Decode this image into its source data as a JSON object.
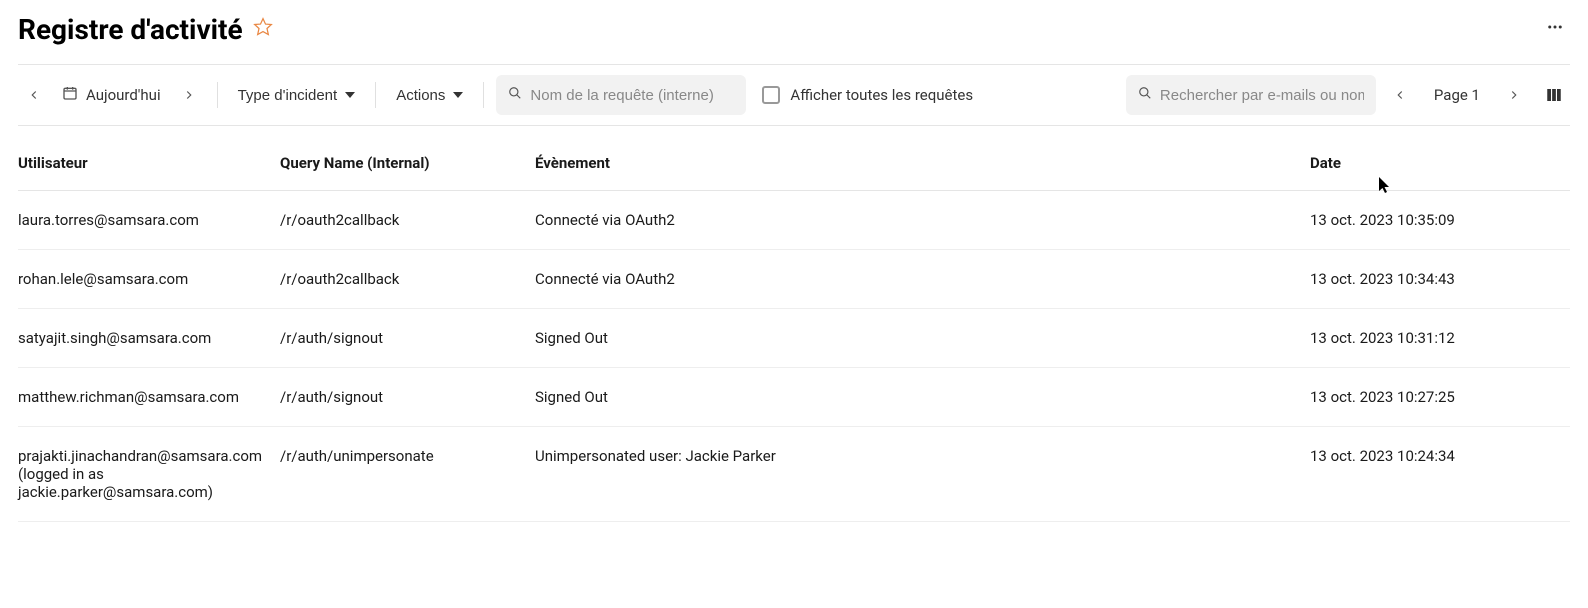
{
  "header": {
    "title": "Registre d'activité"
  },
  "toolbar": {
    "date_range": "Aujourd'hui",
    "incident_type_label": "Type d'incident",
    "actions_label": "Actions",
    "search_query_placeholder": "Nom de la requête (interne)",
    "show_all_label": "Afficher toutes les requêtes",
    "search_email_placeholder": "Rechercher par e-mails ou noms",
    "page_label": "Page 1"
  },
  "table": {
    "headers": {
      "user": "Utilisateur",
      "query": "Query Name (Internal)",
      "event": "Évènement",
      "date": "Date"
    },
    "rows": [
      {
        "user": "laura.torres@samsara.com",
        "query": "/r/oauth2callback",
        "event": "Connecté via OAuth2",
        "date": "13 oct. 2023 10:35:09"
      },
      {
        "user": "rohan.lele@samsara.com",
        "query": "/r/oauth2callback",
        "event": "Connecté via OAuth2",
        "date": "13 oct. 2023 10:34:43"
      },
      {
        "user": "satyajit.singh@samsara.com",
        "query": "/r/auth/signout",
        "event": "Signed Out",
        "date": "13 oct. 2023 10:31:12"
      },
      {
        "user": "matthew.richman@samsara.com",
        "query": "/r/auth/signout",
        "event": "Signed Out",
        "date": "13 oct. 2023 10:27:25"
      },
      {
        "user": "prajakti.jinachandran@samsara.com (logged in as jackie.parker@samsara.com)",
        "query": "/r/auth/unimpersonate",
        "event": "Unimpersonated user: Jackie Parker",
        "date": "13 oct. 2023 10:24:34"
      }
    ]
  }
}
